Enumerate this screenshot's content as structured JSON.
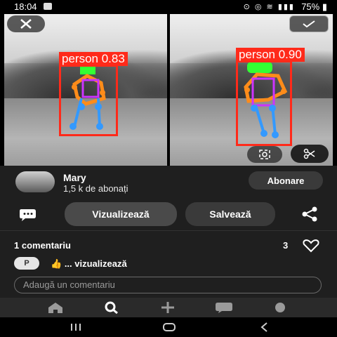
{
  "status_bar": {
    "time": "18:04",
    "battery": "75%"
  },
  "image": {
    "left": {
      "label": "person 0.83"
    },
    "right": {
      "label": "person 0.90"
    },
    "buttons": {
      "close_icon": "close-icon",
      "select_icon": "check-icon",
      "lens_icon": "lens-icon",
      "crop_icon": "scissors-icon"
    }
  },
  "channel": {
    "name": "Mary",
    "subscribers": "1,5 k de abonați",
    "subscribe_label": "Abonare"
  },
  "actions": {
    "visit_label": "Vizualizează",
    "save_label": "Salvează"
  },
  "comments": {
    "header": "1 comentariu",
    "likes": "3",
    "avatar_letter": "P",
    "preview_text": "... vizualizează",
    "input_placeholder": "Adaugă un comentariu"
  },
  "colors": {
    "bbox": "#ff2a1a",
    "skeleton_green": "#33ff33",
    "skeleton_orange": "#ff8c1a",
    "skeleton_blue": "#3399ff",
    "skeleton_pink": "#cc33ff"
  }
}
